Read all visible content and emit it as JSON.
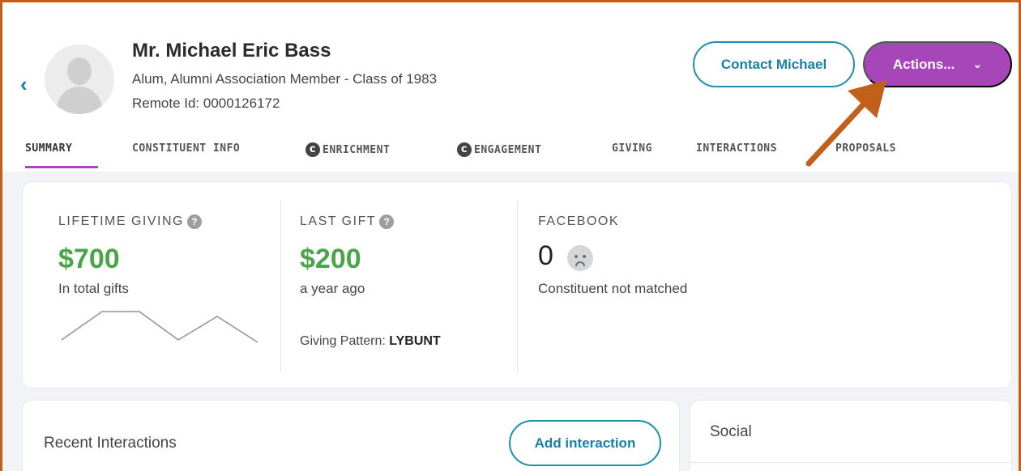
{
  "profile": {
    "name": "Mr. Michael Eric Bass",
    "subtitle": "Alum, Alumni Association Member - Class of 1983",
    "remote_id": "Remote Id: 0000126172"
  },
  "buttons": {
    "contact": "Contact Michael",
    "actions": "Actions...",
    "add_interaction": "Add interaction"
  },
  "tabs": [
    {
      "label": "SUMMARY",
      "active": true
    },
    {
      "label": "CONSTITUENT INFO"
    },
    {
      "label": "ENRICHMENT",
      "icon": "c-circle-icon"
    },
    {
      "label": "ENGAGEMENT",
      "icon": "c-circle-icon"
    },
    {
      "label": "GIVING"
    },
    {
      "label": "INTERACTIONS"
    },
    {
      "label": "PROPOSALS"
    }
  ],
  "stats": {
    "lifetime": {
      "label": "LIFETIME GIVING",
      "value": "$700",
      "caption": "In total gifts"
    },
    "last_gift": {
      "label": "LAST GIFT",
      "value": "$200",
      "caption": "a year ago",
      "pattern_label": "Giving Pattern:",
      "pattern_value": "LYBUNT"
    },
    "facebook": {
      "label": "FACEBOOK",
      "count": "0",
      "caption": "Constituent not matched"
    }
  },
  "cards": {
    "recent_interactions": "Recent Interactions",
    "social": "Social"
  },
  "colors": {
    "accent_purple": "#a646b8",
    "teal": "#1a7fa8",
    "green_value": "#4aa54a",
    "annotation_arrow": "#c0601a"
  }
}
